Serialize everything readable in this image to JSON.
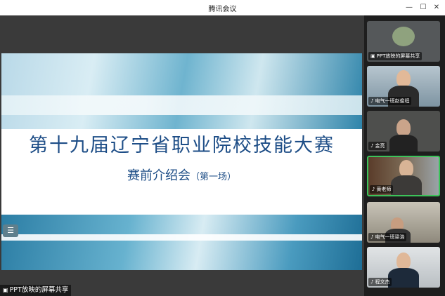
{
  "window": {
    "title": "腾讯会议",
    "controls": {
      "min": "—",
      "max": "☐",
      "close": "✕"
    }
  },
  "slide": {
    "title": "第十九届辽宁省职业院校技能大赛",
    "subtitle": "赛前介绍会",
    "subtitle_note": "（第一场）"
  },
  "main": {
    "list_icon": "☰",
    "share_label": "PPT放映的屏幕共享"
  },
  "participants": [
    {
      "name": "PPT放映的屏幕共享",
      "bg": "#55585a"
    },
    {
      "name": "电气一班赵俊程",
      "bg": "#7a8f9c"
    },
    {
      "name": "金亮",
      "bg": "#4e4f4d"
    },
    {
      "name": "黄老师",
      "bg": "#6b5a45"
    },
    {
      "name": "电气一班梁浩",
      "bg": "#a09a8c"
    },
    {
      "name": "程文杰",
      "bg": "#cfd2d4"
    }
  ],
  "colors": {
    "accent": "#1e4e87",
    "panel": "#1e1e1e"
  }
}
